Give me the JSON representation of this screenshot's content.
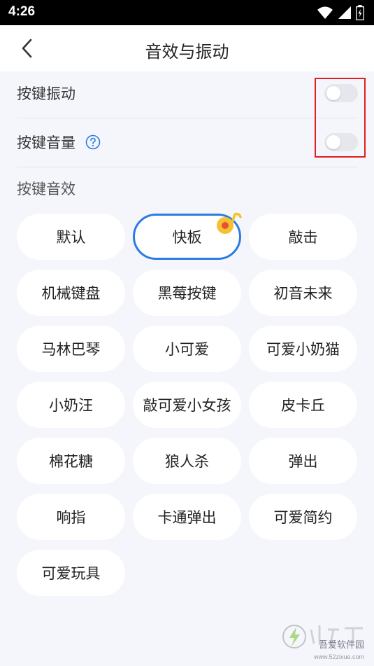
{
  "status_bar": {
    "time": "4:26"
  },
  "header": {
    "title": "音效与振动"
  },
  "settings": [
    {
      "label": "按键振动",
      "enabled": false
    },
    {
      "label": "按键音量",
      "enabled": false
    }
  ],
  "section": {
    "title": "按键音效"
  },
  "sounds": [
    "默认",
    "快板",
    "敲击",
    "机械键盘",
    "黑莓按键",
    "初音未来",
    "马林巴琴",
    "小可爱",
    "可爱小奶猫",
    "小奶汪",
    "敲可爱小女孩",
    "皮卡丘",
    "棉花糖",
    "狼人杀",
    "弹出",
    "响指",
    "卡通弹出",
    "可爱简约",
    "可爱玩具"
  ],
  "selected_sound": "快板",
  "colors": {
    "accent": "#2c7be5",
    "background": "#f4f6fc",
    "highlight": "#e02020",
    "badge": "#f5c133"
  },
  "watermark": {
    "text": "吾爱软件园",
    "url": "www.52zixue.com"
  }
}
